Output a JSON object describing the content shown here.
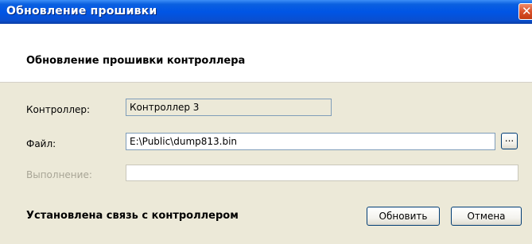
{
  "window": {
    "title": "Обновление прошивки",
    "close_label": "✕"
  },
  "header": {
    "heading": "Обновление прошивки контроллера"
  },
  "form": {
    "controller": {
      "label": "Контроллер:",
      "value": "Контроллер 3"
    },
    "file": {
      "label": "Файл:",
      "value": "E:\\Public\\dump813.bin",
      "browse_label": "..."
    },
    "progress": {
      "label": "Выполнение:",
      "value": ""
    }
  },
  "status": {
    "text": "Установлена связь с контроллером"
  },
  "buttons": {
    "update_label": "Обновить",
    "cancel_label": "Отмена"
  },
  "colors": {
    "titlebar": "#0055e5",
    "dialog_bg": "#ece9d8",
    "field_border": "#7f9db9",
    "close_button": "#d9512b"
  }
}
